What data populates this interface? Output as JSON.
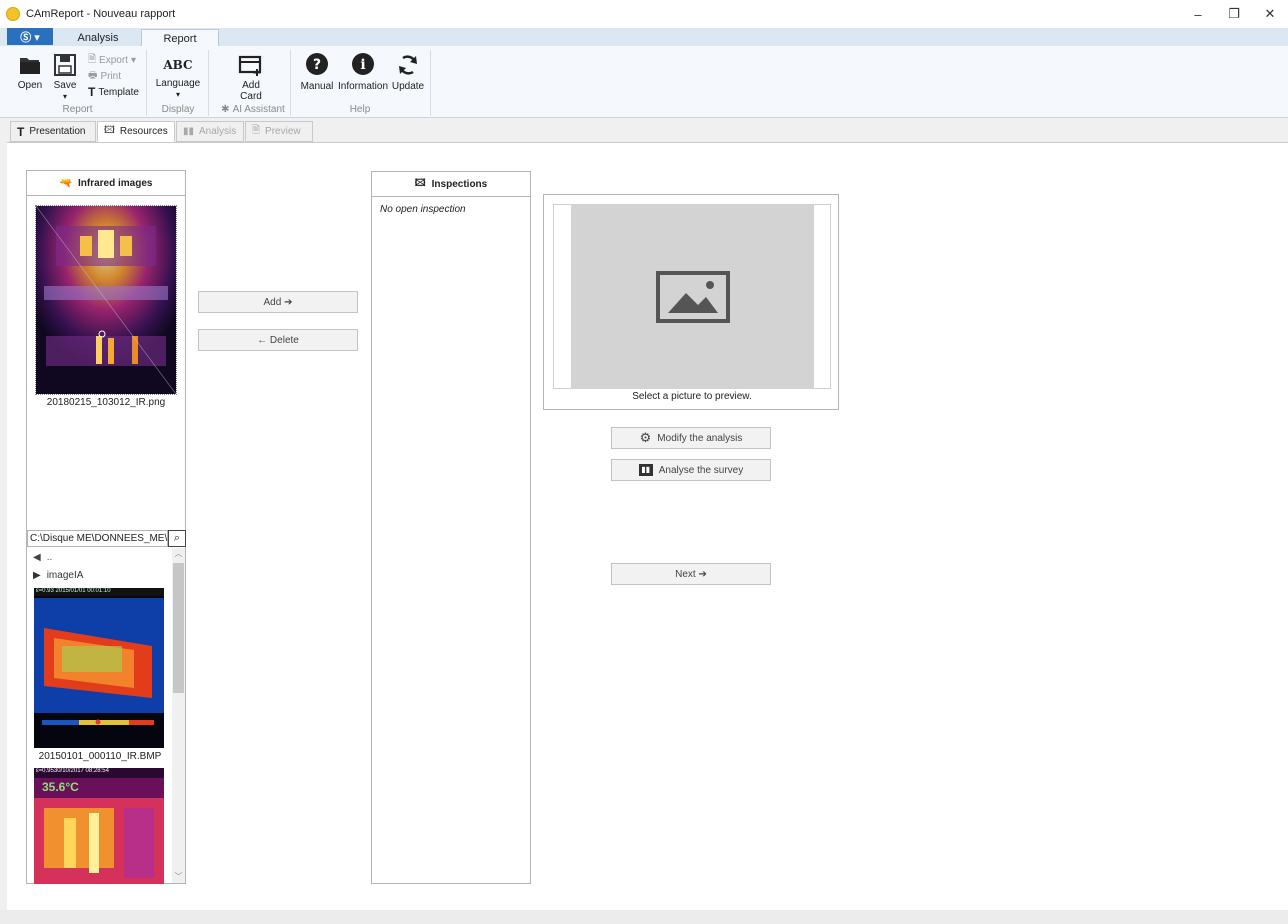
{
  "window": {
    "title": "CAmReport - Nouveau rapport",
    "controls": {
      "minimize": "–",
      "maximize": "❐",
      "close": "✕"
    }
  },
  "ribbon": {
    "app_menu_label": "Ⓢ ▾",
    "tabs": [
      "Analysis",
      "Report"
    ],
    "active_tab": "Report",
    "groups": {
      "report": {
        "label": "Report",
        "open": "Open",
        "save": "Save",
        "export": "Export",
        "print": "Print",
        "template": "Template"
      },
      "display": {
        "label": "Display",
        "language": "Language",
        "abc": "ABC"
      },
      "ai": {
        "label": "AI Assistant",
        "add_card_line1": "Add",
        "add_card_line2": "Card"
      },
      "help": {
        "label": "Help",
        "manual": "Manual",
        "information": "Information",
        "update": "Update"
      }
    }
  },
  "doc_tabs": [
    "Presentation",
    "Resources",
    "Analysis",
    "Preview"
  ],
  "active_doc_tab": "Resources",
  "infrared": {
    "header": "Infrared images",
    "selected_file": "20180215_103012_IR.png",
    "path": "C:\\Disque ME\\DONNEES_ME\\NI",
    "browser": {
      "parent": "..",
      "folder": "imageIA",
      "files": [
        "20150101_000110_IR.BMP"
      ]
    },
    "thumb_overlay_1": "ε=0.93   2015/01/01 00:01:10",
    "thumb_overlay_2": "ε=0.9530/10/2017 08:28:54",
    "thumb_temp_2": "35.6°C"
  },
  "actions": {
    "add": "Add ➔",
    "delete": "←  Delete"
  },
  "inspections": {
    "header": "Inspections",
    "empty_text": "No open inspection"
  },
  "preview": {
    "caption": "Select a picture to preview.",
    "modify": "Modify the analysis",
    "analyse": "Analyse the survey",
    "next": "Next ➔"
  },
  "colors": {
    "accent": "#2b6fbf",
    "ribbon_bg": "#f5f8fc",
    "tab_row": "#dbe7f3"
  }
}
